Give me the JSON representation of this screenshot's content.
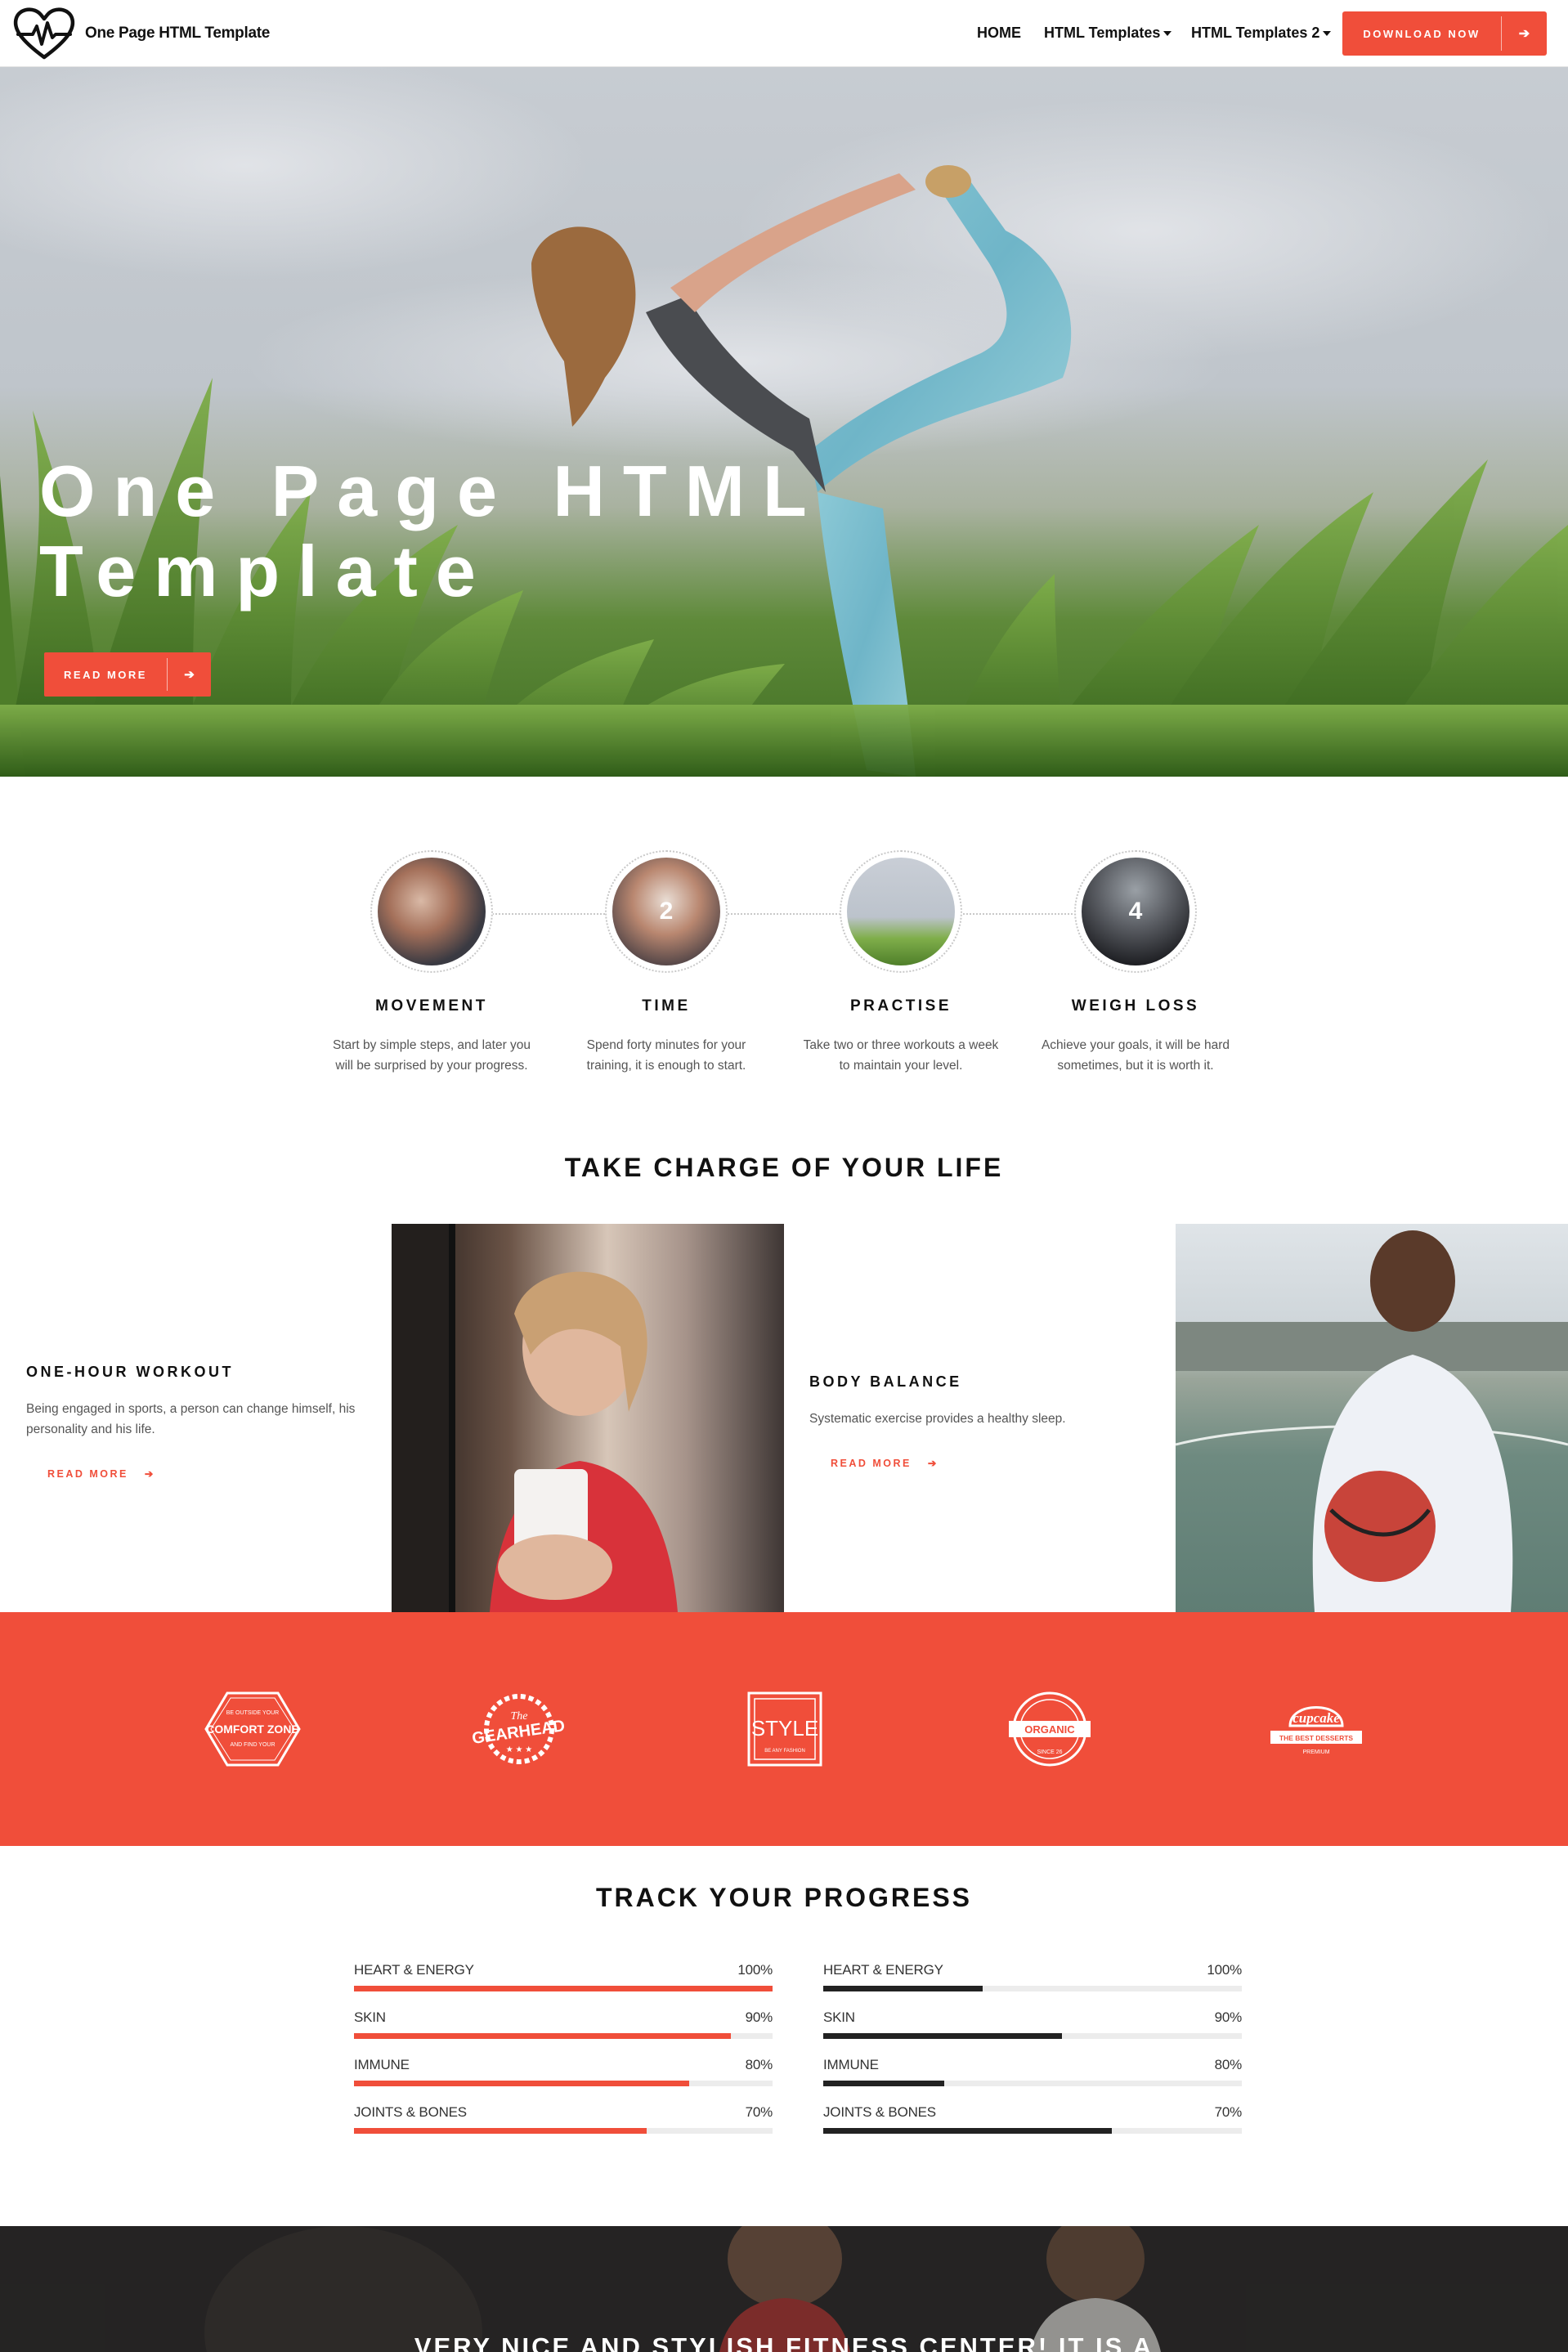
{
  "brand": {
    "name": "One Page HTML Template",
    "logo_icon": "heart-pulse-icon"
  },
  "nav": {
    "home": "HOME",
    "templates1": "HTML Templates",
    "templates2": "HTML Templates 2",
    "download": "DOWNLOAD NOW"
  },
  "hero": {
    "title_line1": "One Page HTML",
    "title_line2": "Template",
    "button": "READ MORE"
  },
  "steps": [
    {
      "title": "MOVEMENT",
      "text": "Start by simple steps, and later you will be surprised by your progress.",
      "badge": ""
    },
    {
      "title": "TIME",
      "text": "Spend forty minutes for your training, it is enough to start.",
      "badge": "2"
    },
    {
      "title": "PRACTISE",
      "text": "Take two or three workouts a week to maintain your level.",
      "badge": ""
    },
    {
      "title": "WEIGH LOSS",
      "text": "Achieve your goals, it will be hard sometimes, but it is worth it.",
      "badge": "4"
    }
  ],
  "take_charge": {
    "title": "TAKE CHARGE OF YOUR LIFE",
    "features": [
      {
        "title": "ONE-HOUR WORKOUT",
        "text": "Being engaged in sports, a person can change himself, his personality and his life.",
        "link": "READ MORE"
      },
      {
        "title": "BODY BALANCE",
        "text": "Systematic exercise provides a healthy sleep.",
        "link": "READ MORE"
      }
    ]
  },
  "clients": {
    "comfort": {
      "top": "BE OUTSIDE YOUR",
      "name": "COMFORT ZONE",
      "bottom": "AND FIND YOUR"
    },
    "gearhead": {
      "top": "The",
      "name": "GEARHEAD"
    },
    "style": {
      "name": "STYLE",
      "bottom": "BE ANY FASHION"
    },
    "organic": {
      "name": "ORGANIC",
      "bottom": "SINCE 26"
    },
    "cupcake": {
      "name": "cupcake",
      "sub": "THE BEST DESSERTS",
      "bottom": "PREMIUM"
    }
  },
  "progress": {
    "title": "TRACK YOUR PROGRESS",
    "left": [
      {
        "label": "HEART & ENERGY",
        "value": "100%",
        "fraction": 1.0
      },
      {
        "label": "SKIN",
        "value": "90%",
        "fraction": 0.9
      },
      {
        "label": "IMMUNE",
        "value": "80%",
        "fraction": 0.8
      },
      {
        "label": "JOINTS & BONES",
        "value": "70%",
        "fraction": 0.7
      }
    ],
    "right": [
      {
        "label": "HEART & ENERGY",
        "value": "100%",
        "fraction": 0.38
      },
      {
        "label": "SKIN",
        "value": "90%",
        "fraction": 0.57
      },
      {
        "label": "IMMUNE",
        "value": "80%",
        "fraction": 0.29
      },
      {
        "label": "JOINTS & BONES",
        "value": "70%",
        "fraction": 0.69
      }
    ]
  },
  "testimonial": {
    "text": "VERY NICE AND STYLISH FITNESS CENTER! IT IS A"
  },
  "colors": {
    "accent": "#f04e3a",
    "dark_bar": "#222222",
    "track": "#ececec"
  }
}
